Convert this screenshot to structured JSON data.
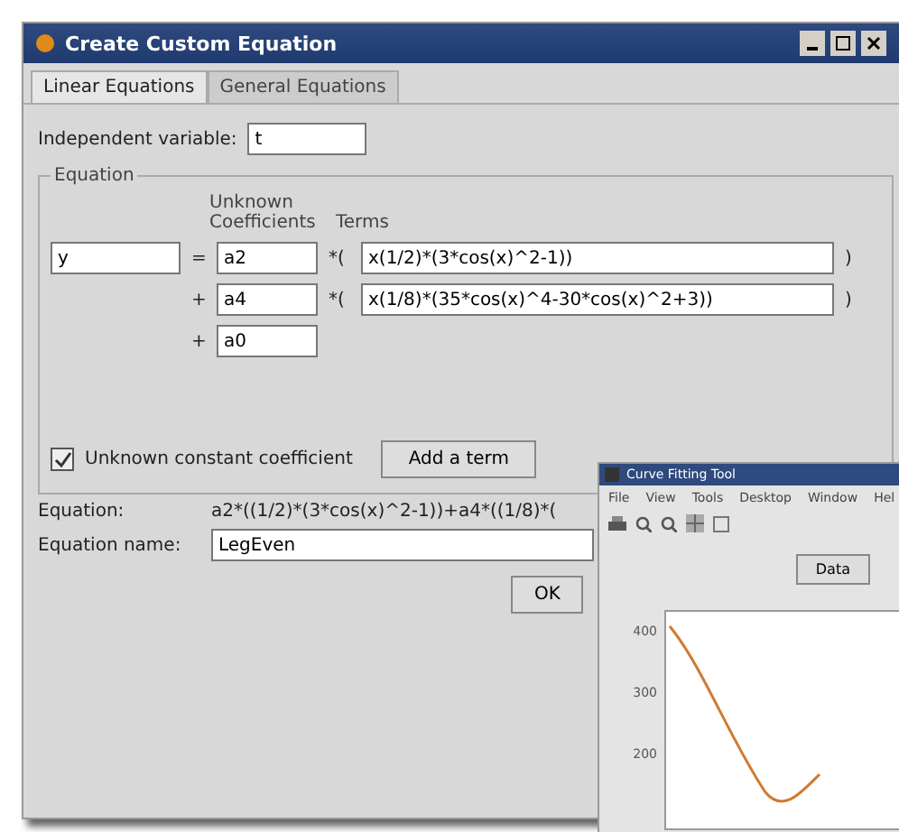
{
  "window": {
    "title": "Create Custom Equation"
  },
  "tabs": [
    {
      "label": "Linear Equations",
      "selected": true
    },
    {
      "label": "General Equations",
      "selected": false
    }
  ],
  "independent_variable": {
    "label": "Independent variable:",
    "value": "t"
  },
  "equation_group": {
    "title": "Equation",
    "coef_heading": "Unknown\nCoefficients",
    "terms_heading": "Terms",
    "lhs": "y",
    "rows": [
      {
        "operator": "=",
        "coefficient": "a2",
        "open": "*(",
        "term": "x(1/2)*(3*cos(x)^2-1))",
        "close": ")"
      },
      {
        "operator": "+",
        "coefficient": "a4",
        "open": "*(",
        "term": "x(1/8)*(35*cos(x)^4-30*cos(x)^2+3))",
        "close": ")"
      },
      {
        "operator": "+",
        "coefficient": "a0"
      }
    ],
    "constant_checkbox": {
      "label": "Unknown constant coefficient",
      "checked": true
    },
    "add_button": "Add a term"
  },
  "equation": {
    "label": "Equation:",
    "value": "a2*((1/2)*(3*cos(x)^2-1))+a4*((1/8)*("
  },
  "equation_name": {
    "label": "Equation name:",
    "value": "LegEven"
  },
  "ok_button": "OK",
  "overlay_window": {
    "title": "Curve Fitting Tool",
    "menu": [
      "File",
      "View",
      "Tools",
      "Desktop",
      "Window",
      "Hel"
    ],
    "button": "Data",
    "y_tick_labels": [
      "400",
      "300",
      "200"
    ]
  }
}
